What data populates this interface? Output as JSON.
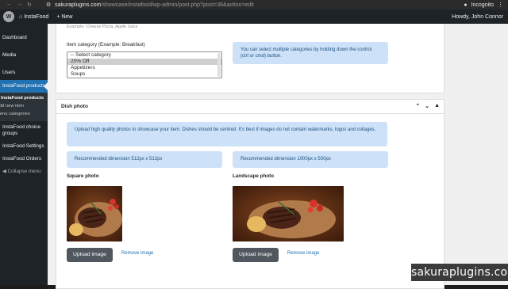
{
  "browser": {
    "url_host": "sakuraplugins.com",
    "url_path": "/showcase/instafood/wp-admin/post.php?post=36&action=edit",
    "profile": "Incognito"
  },
  "admin_bar": {
    "site_name": "InstaFood",
    "new_label": "New",
    "howdy": "Howdy, John Connor"
  },
  "sidebar": {
    "items": [
      {
        "label": "Dashboard"
      },
      {
        "label": "Media"
      },
      {
        "label": "Users"
      },
      {
        "label": "InstaFood products"
      }
    ],
    "submenu": {
      "head": "InstaFood products",
      "items": [
        "Add new item",
        "Menu categories"
      ]
    },
    "more_items": [
      {
        "label": "InstaFood choice groups"
      },
      {
        "label": "InstaFood Settings"
      },
      {
        "label": "InstaFood Orders"
      },
      {
        "label": "Collapse menu"
      }
    ]
  },
  "category_section": {
    "example_text": "Example: Cheese Pizza, Apple Juice",
    "label": "Item category (Example: Breakfast)",
    "options": [
      "-- Select category",
      "20% Off",
      "Appetizers",
      "Soups"
    ],
    "selected": "20% Off",
    "info": "You can select multiple categories by holding down the control (ctrl or cmd) button."
  },
  "dish_photo": {
    "title": "Dish photo",
    "info": "Upload high quality photos to showcase your item. Dishes should be centred. It's best if images do not contain watermarks, logos and collages.",
    "square": {
      "dimension": "Recommended dimension 512px x 512px",
      "label": "Square photo",
      "upload": "Upload image",
      "remove": "Remove image"
    },
    "landscape": {
      "dimension": "Recommended dimension 1000px x 500px",
      "label": "Landscape photo",
      "upload": "Upload image",
      "remove": "Remove image"
    }
  },
  "watermark": "sakuraplugins.com",
  "colors": {
    "admin_dark": "#1d2327",
    "accent_blue": "#2271b1",
    "info_blue": "#cde2f9",
    "button_gray": "#50575e"
  }
}
